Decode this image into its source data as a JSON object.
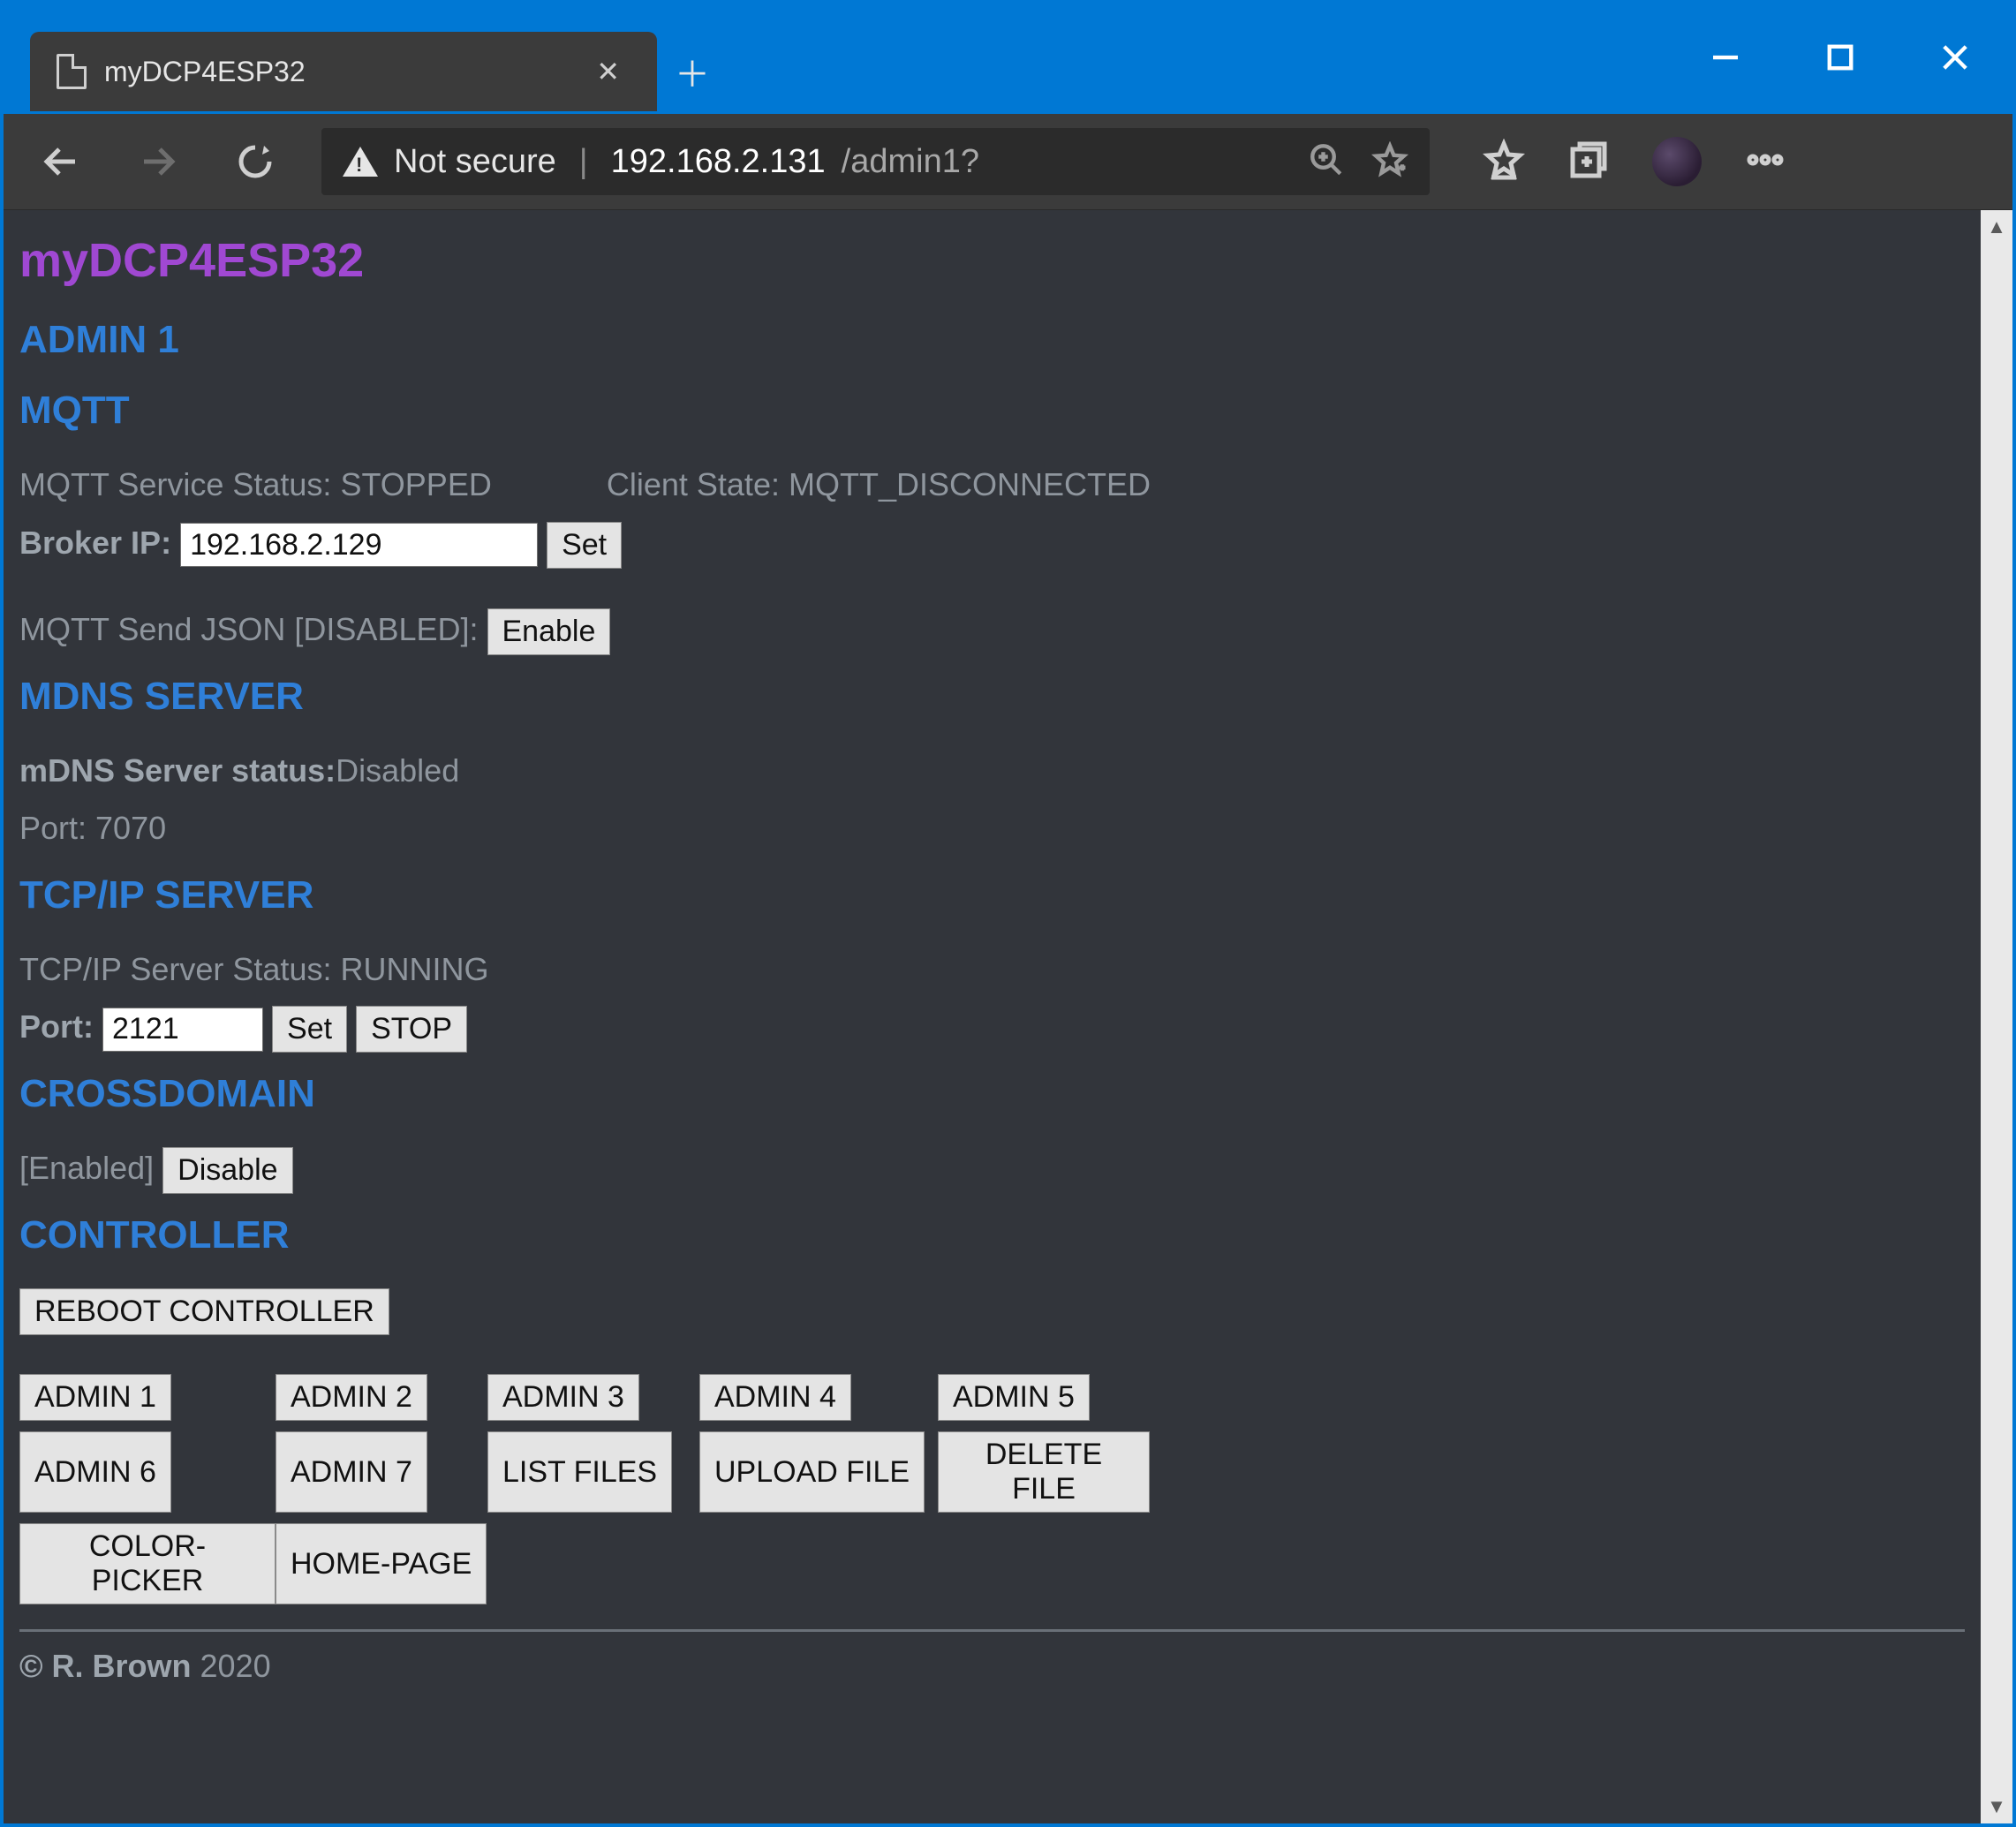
{
  "browser": {
    "tab_title": "myDCP4ESP32",
    "not_secure_label": "Not secure",
    "url_host": "192.168.2.131",
    "url_path": "/admin1?"
  },
  "page_title": "myDCP4ESP32",
  "admin_heading": "ADMIN 1",
  "mqtt": {
    "heading": "MQTT",
    "status_label": "MQTT Service Status: ",
    "status_value": "STOPPED",
    "client_label": "Client State: ",
    "client_value": "MQTT_DISCONNECTED",
    "broker_label": "Broker IP: ",
    "broker_value": "192.168.2.129",
    "set_label": "Set",
    "json_label": "MQTT Send JSON [DISABLED]: ",
    "enable_label": "Enable"
  },
  "mdns": {
    "heading": "MDNS SERVER",
    "status_label": "mDNS Server status:",
    "status_value": "Disabled",
    "port_label": "Port: ",
    "port_value": "7070"
  },
  "tcpip": {
    "heading": "TCP/IP SERVER",
    "status_label": "TCP/IP Server Status: ",
    "status_value": "RUNNING",
    "port_label": "Port: ",
    "port_value": "2121",
    "set_label": "Set",
    "stop_label": "STOP"
  },
  "crossdomain": {
    "heading": "CROSSDOMAIN",
    "status": "[Enabled]",
    "disable_label": "Disable"
  },
  "controller": {
    "heading": "CONTROLLER",
    "reboot_label": "REBOOT CONTROLLER"
  },
  "nav": {
    "admin1": "ADMIN 1",
    "admin2": "ADMIN 2",
    "admin3": "ADMIN 3",
    "admin4": "ADMIN 4",
    "admin5": "ADMIN 5",
    "admin6": "ADMIN 6",
    "admin7": "ADMIN 7",
    "list_files": "LIST FILES",
    "upload_file": "UPLOAD FILE",
    "delete_file": "DELETE FILE",
    "color_picker": "COLOR-PICKER",
    "home_page": "HOME-PAGE"
  },
  "footer": {
    "copyright": "© R. Brown",
    "year": " 2020"
  }
}
